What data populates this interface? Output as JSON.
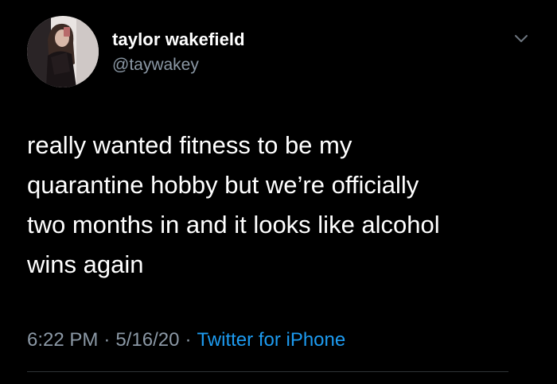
{
  "user": {
    "display_name": "taylor wakefield",
    "handle": "@taywakey"
  },
  "tweet": {
    "text": "really wanted fitness to be my\nquarantine hobby but we’re officially\ntwo months in and it looks like alcohol\nwins again",
    "time": "6:22 PM",
    "date": "5/16/20",
    "source": "Twitter for iPhone",
    "separator": "·"
  },
  "icons": {
    "avatar": "profile-photo",
    "menu": "chevron-down-icon"
  },
  "colors": {
    "background": "#000000",
    "text": "#ffffff",
    "secondary_text": "#8b98a5",
    "link": "#1d9bf0"
  }
}
